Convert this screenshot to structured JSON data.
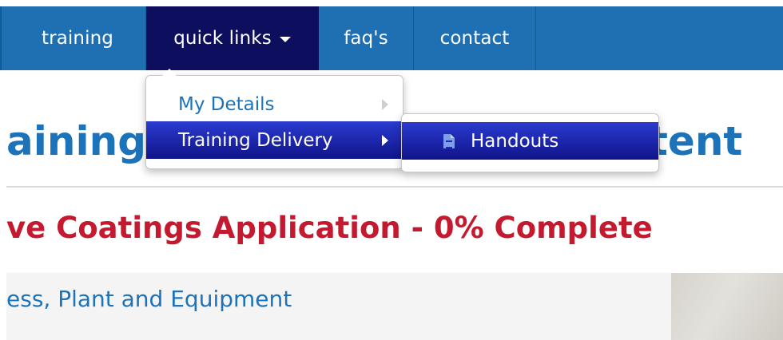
{
  "nav": {
    "items": [
      {
        "label": "training"
      },
      {
        "label": "quick links"
      },
      {
        "label": "faq's"
      },
      {
        "label": "contact"
      }
    ]
  },
  "dropdown": {
    "items": [
      {
        "label": "My Details"
      },
      {
        "label": "Training Delivery"
      }
    ],
    "submenu": {
      "items": [
        {
          "label": "Handouts",
          "icon": "document-icon"
        }
      ]
    }
  },
  "page": {
    "title_visible": "aining",
    "title_tail": "tent",
    "course_heading": "ve Coatings Application - 0% Complete",
    "module_link": "ess, Plant and Equipment"
  },
  "colors": {
    "nav_bg": "#1f6fb3",
    "nav_active": "#0d0f5e",
    "title": "#1d73b9",
    "heading_red": "#c41a30",
    "menu_highlight": "#1a25b0"
  }
}
